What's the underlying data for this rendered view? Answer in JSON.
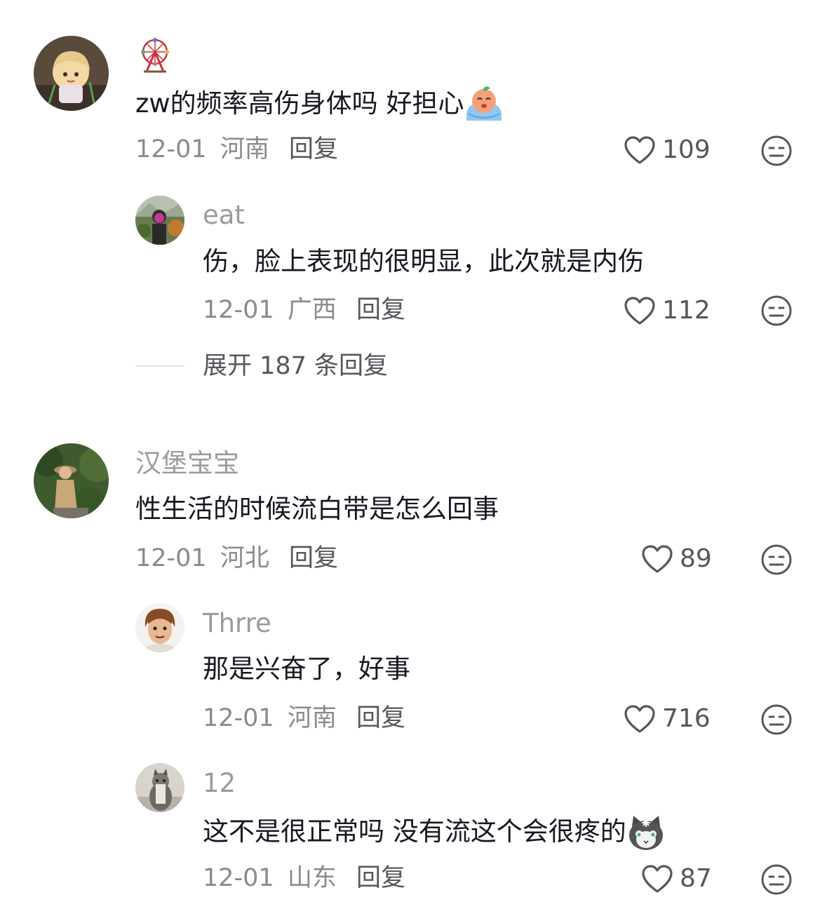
{
  "comments": [
    {
      "username": "",
      "text": "zw的频率高伤身体吗 好担心",
      "date": "12-01",
      "location": "河南",
      "reply_label": "回复",
      "likes": "109",
      "avatar_icon": "anime-girl-avatar",
      "badge_icon": "ferris-wheel-icon",
      "trailing_emoji": "crying-emoji-icon",
      "replies": [
        {
          "username": "eat",
          "text": "伤，脸上表现的很明显，此次就是内伤",
          "date": "12-01",
          "location": "广西",
          "reply_label": "回复",
          "likes": "112",
          "avatar_icon": "person-photo-avatar"
        }
      ],
      "expand_label": "展开 187 条回复"
    },
    {
      "username": "汉堡宝宝",
      "text": "性生活的时候流白带是怎么回事",
      "date": "12-01",
      "location": "河北",
      "reply_label": "回复",
      "likes": "89",
      "avatar_icon": "woman-photo-avatar",
      "replies": [
        {
          "username": "Thrre",
          "text": "那是兴奋了，好事",
          "date": "12-01",
          "location": "河南",
          "reply_label": "回复",
          "likes": "716",
          "avatar_icon": "cartoon-boy-avatar"
        },
        {
          "username": "12",
          "text": "这不是很正常吗 没有流这个会很疼的",
          "date": "12-01",
          "location": "山东",
          "reply_label": "回复",
          "likes": "87",
          "avatar_icon": "cat-photo-avatar",
          "trailing_emoji": "cat-emoji-icon"
        }
      ]
    }
  ],
  "colors": {
    "text_primary": "#161823",
    "text_secondary": "#8a8a90",
    "username": "#9a9aa0",
    "icon": "#56565c",
    "divider": "#e6e6e8"
  }
}
